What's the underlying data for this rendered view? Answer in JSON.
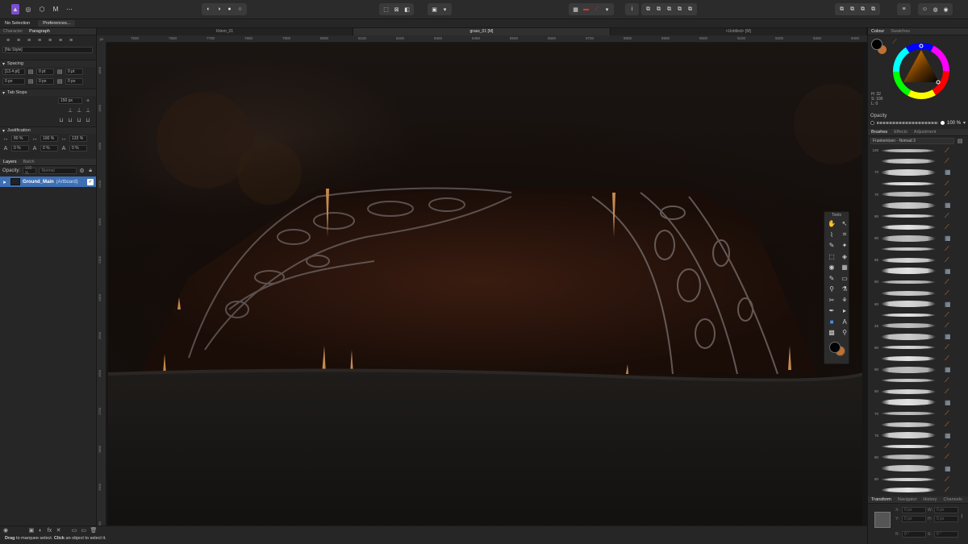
{
  "context_bar": {
    "selection": "No Selection",
    "preferences": "Preferences..."
  },
  "left_panel": {
    "tabs": [
      {
        "label": "Character",
        "active": false
      },
      {
        "label": "Paragraph",
        "active": true
      }
    ],
    "style_value": "[No Style]",
    "spacing": {
      "title": "Spacing",
      "row1": [
        "[13.4 pt]",
        "0 pt",
        "0 pt"
      ],
      "row2": [
        "0 px",
        "0 px",
        "0 px"
      ]
    },
    "tab_stops": {
      "title": "Tab Stops",
      "value": "150 px"
    },
    "justification": {
      "title": "Justification",
      "row1": [
        "80 %",
        "100 %",
        "133 %"
      ],
      "row2": [
        "0 %",
        "0 %",
        "0 %"
      ]
    },
    "layers": {
      "tabs": [
        {
          "label": "Layers",
          "active": true
        },
        {
          "label": "Batch",
          "active": false
        }
      ],
      "opacity_label": "Opacity:",
      "opacity_value": "100 %",
      "blend_mode": "Normal",
      "layer_name": "Ground_Main",
      "layer_type": "(Artboard)"
    }
  },
  "document_tabs": [
    {
      "label": "Kitem_01",
      "active": false
    },
    {
      "label": "grass_01 [M]",
      "active": true
    },
    {
      "label": "<Untitled> [M]",
      "active": false
    }
  ],
  "ruler": {
    "h_ticks": [
      "7500",
      "7600",
      "7700",
      "7800",
      "7900",
      "8000",
      "8100",
      "8200",
      "8300",
      "8400",
      "8500",
      "8600",
      "8700",
      "8800",
      "8900",
      "9000",
      "9100",
      "9200",
      "9300",
      "9400"
    ],
    "v_ticks": [
      "1800",
      "1900",
      "2000",
      "2100",
      "2200",
      "2300",
      "2400",
      "2500",
      "2600",
      "2700",
      "2800",
      "2900",
      "3000"
    ],
    "unit": "px"
  },
  "right_panel": {
    "colour_tabs": [
      {
        "label": "Colour",
        "active": true
      },
      {
        "label": "Swatches",
        "active": false
      }
    ],
    "hsl": {
      "h": "H: 32",
      "s": "S: 100",
      "l": "L: 0"
    },
    "opacity_label": "Opacity",
    "opacity_value": "100 %",
    "brushes_tabs": [
      {
        "label": "Brushes",
        "active": true
      },
      {
        "label": "Effects",
        "active": false
      },
      {
        "label": "Adjustment",
        "active": false
      }
    ],
    "brush_category": "Frankentoon - Nomad 3",
    "brush_sizes": [
      "100",
      "",
      "70",
      "",
      "70",
      "",
      "90",
      "",
      "90",
      "",
      "65",
      "",
      "60",
      "",
      "60",
      "",
      "25",
      "",
      "90",
      "",
      "90",
      "",
      "50",
      "",
      "70",
      "",
      "75",
      "",
      "80",
      "",
      "80",
      ""
    ],
    "transform_tabs": [
      {
        "label": "Transform",
        "active": true
      },
      {
        "label": "Navigator",
        "active": false
      },
      {
        "label": "History",
        "active": false
      },
      {
        "label": "Channels",
        "active": false
      }
    ],
    "transform": {
      "x_label": "X:",
      "x": "0 px",
      "w_label": "W:",
      "w": "0 px",
      "y_label": "Y:",
      "y": "0 px",
      "h_label": "H:",
      "h": "0 px",
      "r_label": "R:",
      "r": "0 °",
      "s_label": "S:",
      "s": "0 °"
    }
  },
  "tools_panel": {
    "title": "Tools"
  },
  "status": {
    "prefix_bold": "Drag",
    "text1": " to marquee select. ",
    "mid_bold": "Click",
    "text2": " an object to select it."
  },
  "colors": {
    "primary": "#000000",
    "secondary": "#c07030",
    "accent": "#3d6fb5"
  }
}
